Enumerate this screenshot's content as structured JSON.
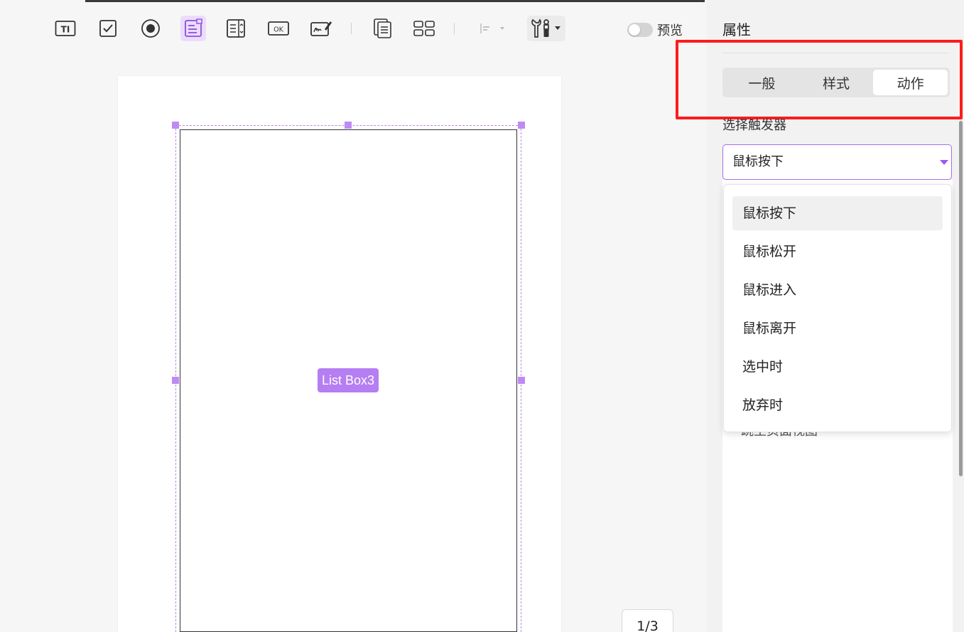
{
  "toolbar": {
    "tools": [
      "text-field",
      "checkbox",
      "radio-button",
      "list-box",
      "combo-box",
      "button",
      "signature",
      "duplicate-pages",
      "grid-layout",
      "align",
      "tools-menu"
    ],
    "preview_label": "预览"
  },
  "canvas": {
    "field_name": "List Box3",
    "page_indicator": "1/3"
  },
  "panel": {
    "title": "属性",
    "tabs": [
      {
        "label": "一般",
        "active": false
      },
      {
        "label": "样式",
        "active": false
      },
      {
        "label": "动作",
        "active": true
      }
    ],
    "trigger_label": "选择触发器",
    "trigger_value": "鼠标按下",
    "obscured_text": "跳至页面视图",
    "trigger_options": [
      "鼠标按下",
      "鼠标松开",
      "鼠标进入",
      "鼠标离开",
      "选中时",
      "放弃时"
    ]
  },
  "colors": {
    "accent": "#b57ef2",
    "highlight_box": "#ff1b1b",
    "active_tool_bg": "#ecdcfb"
  }
}
